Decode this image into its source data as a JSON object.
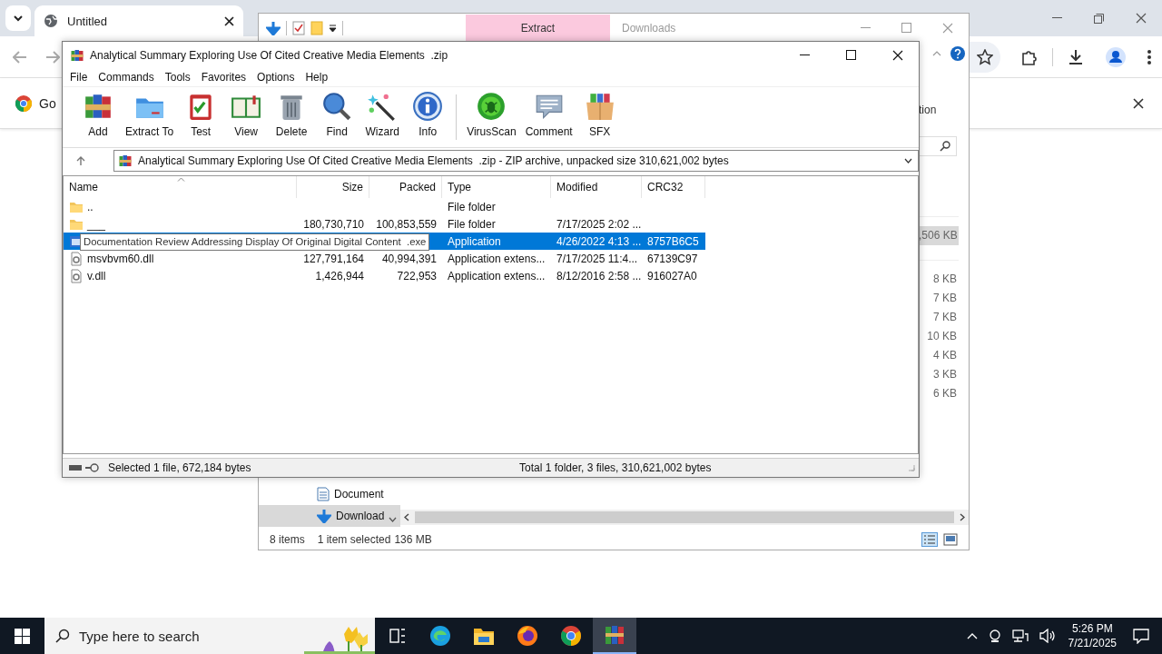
{
  "browser": {
    "tab": {
      "title": "Untitled"
    },
    "infobar": {
      "text": "Go"
    }
  },
  "explorer": {
    "context_tab": {
      "label": "Extract",
      "selected": true
    },
    "title": "Downloads",
    "ribbon_text": "tion",
    "groups": [
      {
        "files": [
          {
            "size": ",506 KB",
            "selected": true
          }
        ]
      },
      {
        "files": [
          {
            "size": "8 KB",
            "selected": false
          },
          {
            "size": "7 KB",
            "selected": false
          },
          {
            "size": "7 KB",
            "selected": false
          },
          {
            "size": "10 KB",
            "selected": false
          },
          {
            "size": "4 KB",
            "selected": false
          },
          {
            "size": "3 KB",
            "selected": false
          },
          {
            "size": "6 KB",
            "selected": false
          }
        ]
      }
    ],
    "nav": [
      {
        "label": "Document",
        "selected": false
      },
      {
        "label": "Download",
        "selected": true
      }
    ],
    "status": {
      "items": "8 items",
      "selection": "1 item selected",
      "size": "136 MB"
    }
  },
  "winrar": {
    "title": "Analytical Summary Exploring Use Of Cited Creative Media Elements  .zip",
    "menu": [
      "File",
      "Commands",
      "Tools",
      "Favorites",
      "Options",
      "Help"
    ],
    "toolbar": [
      "Add",
      "Extract To",
      "Test",
      "View",
      "Delete",
      "Find",
      "Wizard",
      "Info",
      "VirusScan",
      "Comment",
      "SFX"
    ],
    "address": "Analytical Summary Exploring Use Of Cited Creative Media Elements  .zip - ZIP archive, unpacked size 310,621,002 bytes",
    "columns": [
      "Name",
      "Size",
      "Packed",
      "Type",
      "Modified",
      "CRC32"
    ],
    "rows": [
      {
        "kind": "folder",
        "name": "..",
        "type": "File folder",
        "selected": false
      },
      {
        "kind": "folder",
        "name": "___",
        "size": "180,730,710",
        "packed": "100,853,559",
        "type": "File folder",
        "modified": "7/17/2025 2:02 ...",
        "selected": false
      },
      {
        "kind": "exe",
        "type": "Application",
        "modified": "4/26/2022 4:13 ...",
        "crc32": "8757B6C5",
        "selected": true
      },
      {
        "kind": "dll",
        "name": "msvbvm60.dll",
        "size": "127,791,164",
        "packed": "40,994,391",
        "type": "Application extens...",
        "modified": "7/17/2025 11:4...",
        "crc32": "67139C97",
        "selected": false
      },
      {
        "kind": "dll",
        "name": "v.dll",
        "size": "1,426,944",
        "packed": "722,953",
        "type": "Application extens...",
        "modified": "8/12/2016 2:58 ...",
        "crc32": "916027A0",
        "selected": false
      }
    ],
    "tooltip": "Documentation Review Addressing Display Of Original Digital Content  .exe",
    "status": {
      "left": "Selected 1 file, 672,184 bytes",
      "right": "Total 1 folder, 3 files, 310,621,002 bytes"
    }
  },
  "taskbar": {
    "search": {
      "placeholder": "Type here to search"
    },
    "apps": [
      {
        "selected": false
      },
      {
        "selected": false
      },
      {
        "selected": false
      },
      {
        "selected": false
      },
      {
        "selected": true
      }
    ],
    "clock": {
      "time": "5:26 PM",
      "date": "7/21/2025"
    }
  }
}
